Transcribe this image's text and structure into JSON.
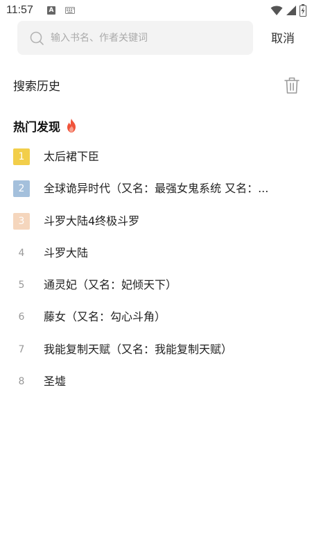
{
  "status_bar": {
    "time": "11:57",
    "a_icon_text": "A",
    "icons": [
      "keyboard-icon",
      "wifi-icon",
      "signal-icon",
      "battery-icon"
    ]
  },
  "search": {
    "placeholder": "输入书名、作者关键词",
    "value": "",
    "cancel_label": "取消"
  },
  "history": {
    "title": "搜索历史"
  },
  "hot": {
    "title": "热门发现",
    "items": [
      {
        "rank": "1",
        "title": "太后裙下臣",
        "badge_color": "#f2ce4a"
      },
      {
        "rank": "2",
        "title": "全球诡异时代（又名：最强女鬼系统 又名：...",
        "badge_color": "#a4c0dc"
      },
      {
        "rank": "3",
        "title": "斗罗大陆4终极斗罗",
        "badge_color": "#f5d6bd"
      },
      {
        "rank": "4",
        "title": "斗罗大陆",
        "badge_color": ""
      },
      {
        "rank": "5",
        "title": "通灵妃（又名：妃倾天下）",
        "badge_color": ""
      },
      {
        "rank": "6",
        "title": "藤女（又名：勾心斗角）",
        "badge_color": ""
      },
      {
        "rank": "7",
        "title": "我能复制天赋（又名：我能复制天赋）",
        "badge_color": ""
      },
      {
        "rank": "8",
        "title": "圣墟",
        "badge_color": ""
      }
    ]
  }
}
